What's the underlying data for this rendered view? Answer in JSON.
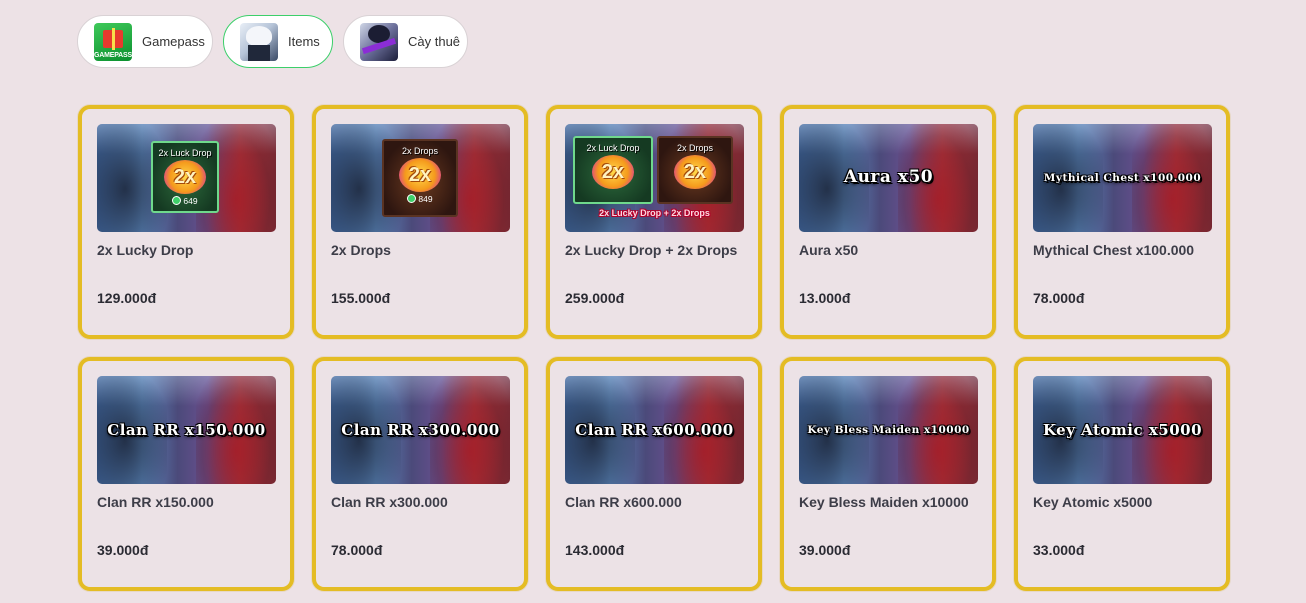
{
  "tabs": [
    {
      "label": "Gamepass",
      "thumb_text": "GAMEPASS",
      "active": false
    },
    {
      "label": "Items",
      "active": true
    },
    {
      "label": "Cày thuê",
      "active": false
    }
  ],
  "products": [
    {
      "name": "2x Lucky Drop",
      "price": "129.000đ",
      "badge": {
        "title": "2x Luck Drop",
        "value": "2x",
        "price": "649"
      }
    },
    {
      "name": "2x Drops",
      "price": "155.000đ",
      "badge": {
        "title": "2x Drops",
        "value": "2x",
        "price": "849"
      }
    },
    {
      "name": "2x Lucky Drop + 2x Drops",
      "price": "259.000đ",
      "combo": {
        "left_title": "2x Luck Drop",
        "right_title": "2x Drops",
        "value": "2x",
        "caption": "2x Lucky Drop + 2x Drops"
      }
    },
    {
      "name": "Aura x50",
      "price": "13.000đ",
      "overlay": "Aura x50"
    },
    {
      "name": "Mythical Chest x100.000",
      "price": "78.000đ",
      "overlay": "Mythical Chest x100.000"
    },
    {
      "name": "Clan RR x150.000",
      "price": "39.000đ",
      "overlay": "Clan RR x150.000"
    },
    {
      "name": "Clan RR x300.000",
      "price": "78.000đ",
      "overlay": "Clan RR x300.000"
    },
    {
      "name": "Clan RR x600.000",
      "price": "143.000đ",
      "overlay": "Clan RR x600.000"
    },
    {
      "name": "Key Bless Maiden x10000",
      "price": "39.000đ",
      "overlay": "Key Bless Maiden x10000"
    },
    {
      "name": "Key Atomic x5000",
      "price": "33.000đ",
      "overlay": "Key Atomic x5000"
    }
  ],
  "colors": {
    "background": "#ede2e6",
    "card_border": "#e4bc24",
    "active_tab_border": "#3ccf6a"
  }
}
